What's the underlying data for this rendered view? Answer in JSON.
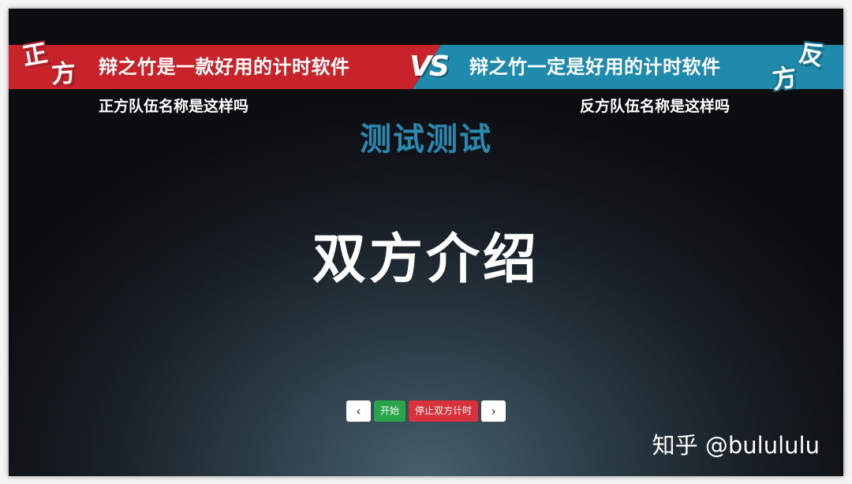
{
  "pro": {
    "badge_chars": [
      "正",
      "方"
    ],
    "motion": "辩之竹是一款好用的计时软件",
    "team": "正方队伍名称是这样吗",
    "color": "#c8222a"
  },
  "con": {
    "badge_chars": [
      "方",
      "反"
    ],
    "motion": "辩之竹一定是好用的计时软件",
    "team": "反方队伍名称是这样吗",
    "color": "#1f8aac"
  },
  "vs_label": "VS",
  "subject": "测试测试",
  "stage_title": "双方介绍",
  "controls": {
    "prev_icon": "chevron-left-icon",
    "prev_glyph": "‹",
    "start_label": "开始",
    "stop_label": "停止双方计时",
    "next_icon": "chevron-right-icon",
    "next_glyph": "›"
  },
  "watermark": "知乎 @bulululu"
}
